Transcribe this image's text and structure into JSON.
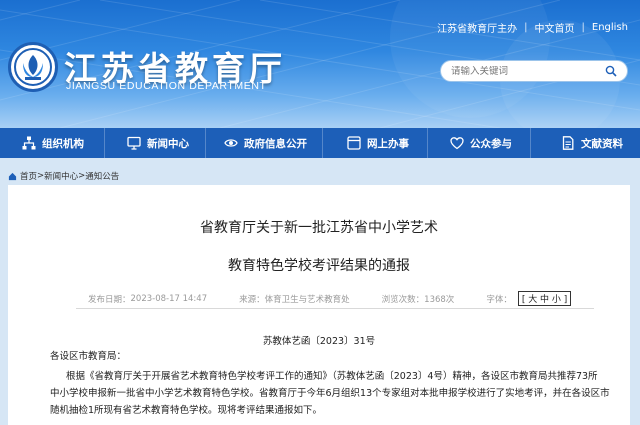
{
  "header": {
    "site_title": "江苏省教育厅",
    "site_subtitle": "JIANGSU EDUCATION DEPARTMENT",
    "top_links": [
      "江苏省教育厅主办",
      "中文首页",
      "English"
    ],
    "search_placeholder": "请输入关键词",
    "colors": {
      "header_blue": "#2f87e0",
      "nav_blue": "#1d5fb8"
    }
  },
  "nav": {
    "items": [
      {
        "label": "组织机构",
        "icon": "org-chart-icon"
      },
      {
        "label": "新闻中心",
        "icon": "monitor-icon"
      },
      {
        "label": "政府信息公开",
        "icon": "eye-icon"
      },
      {
        "label": "网上办事",
        "icon": "screen-icon"
      },
      {
        "label": "公众参与",
        "icon": "heart-icon"
      },
      {
        "label": "文献资料",
        "icon": "document-icon"
      }
    ]
  },
  "breadcrumb": {
    "home": "首页",
    "sep": ">",
    "level1": "新闻中心",
    "level2": "通知公告"
  },
  "article": {
    "title_line1": "省教育厅关于新一批江苏省中小学艺术",
    "title_line2": "教育特色学校考评结果的通报",
    "meta": {
      "date_label": "发布日期：",
      "date": "2023-08-17 14:47",
      "source_label": "来源：",
      "source": "体育卫生与艺术教育处",
      "views_label": "浏览次数：",
      "views": "1368次",
      "fontsize_label": "字体：",
      "fontsize_options": "[ 大 中 小 ]"
    },
    "doc_number": "苏教体艺函〔2023〕31号",
    "salutation": "各设区市教育局：",
    "body_line1": "根据《省教育厅关于开展省艺术教育特色学校考评工作的通知》（苏教体艺函〔2023〕4号）精神，各设区市教育局共推荐73所",
    "body_line2": "中小学校申报新一批省中小学艺术教育特色学校。省教育厅于今年6月组织13个专家组对本批申报学校进行了实地考评，并在各设区市",
    "body_line3": "随机抽检1所现有省艺术教育特色学校。现将考评结果通报如下。"
  }
}
